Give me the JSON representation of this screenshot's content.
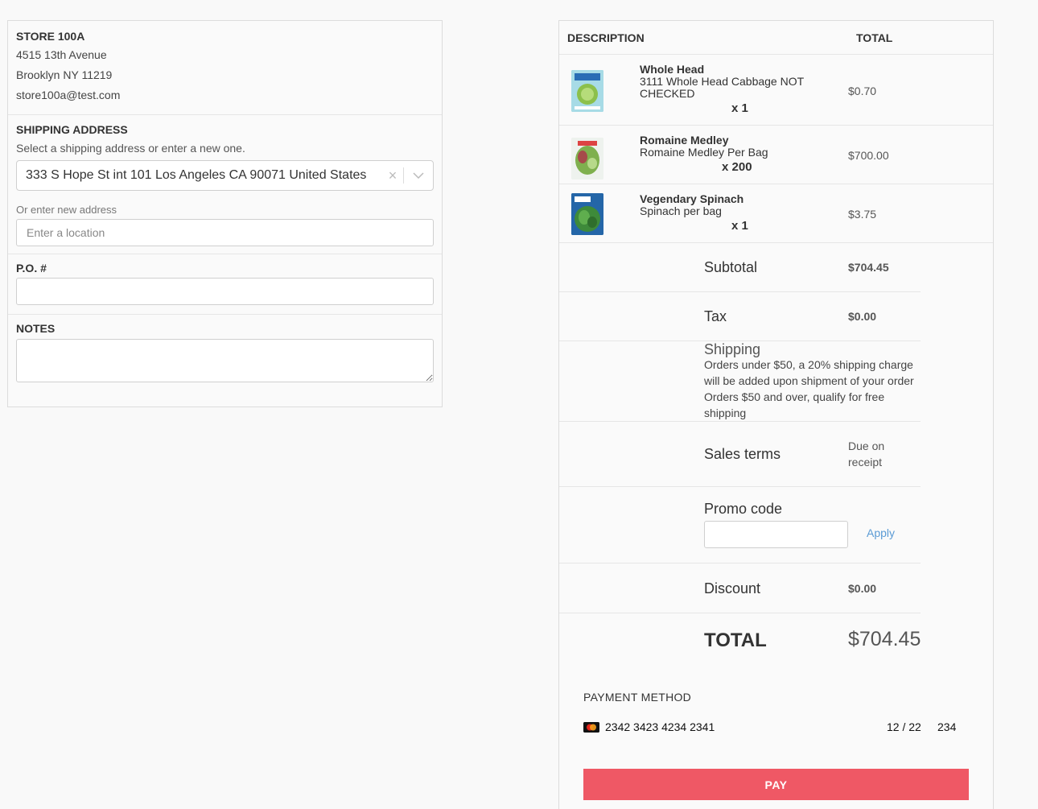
{
  "store": {
    "name": "STORE 100A",
    "street": "4515 13th Avenue",
    "city": "Brooklyn NY 11219",
    "email": "store100a@test.com"
  },
  "shipping": {
    "title": "SHIPPING ADDRESS",
    "helper": "Select a shipping address or enter a new one.",
    "selected_address": "333 S Hope St int 101 Los Angeles CA 90071 United States",
    "clear_glyph": "×",
    "new_address_label": "Or enter new address",
    "new_address_placeholder": "Enter a location"
  },
  "po": {
    "title": "P.O. #",
    "value": ""
  },
  "notes": {
    "title": "NOTES",
    "value": ""
  },
  "order": {
    "header_description": "DESCRIPTION",
    "header_total": "TOTAL",
    "items": [
      {
        "title": "Whole Head",
        "description": "3111 Whole Head Cabbage NOT CHECKED",
        "quantity": "x 1",
        "price": "$0.70",
        "thumb_icon": "cabbage-product-image"
      },
      {
        "title": "Romaine Medley",
        "description": "Romaine Medley Per Bag",
        "quantity": "x 200",
        "price": "$700.00",
        "thumb_icon": "romaine-product-image"
      },
      {
        "title": "Vegendary Spinach",
        "description": "Spinach per bag",
        "quantity": "x 1",
        "price": "$3.75",
        "thumb_icon": "spinach-product-image"
      }
    ]
  },
  "summary": {
    "subtotal_label": "Subtotal",
    "subtotal_value": "$704.45",
    "tax_label": "Tax",
    "tax_value": "$0.00",
    "shipping_label": "Shipping",
    "shipping_note": "Orders under $50, a 20% shipping charge will be added upon shipment of your order Orders $50 and over, qualify for free shipping",
    "sales_terms_label": "Sales terms",
    "sales_terms_value": "Due on receipt",
    "promo_label": "Promo code",
    "promo_value": "",
    "apply_label": "Apply",
    "discount_label": "Discount",
    "discount_value": "$0.00",
    "total_label": "TOTAL",
    "total_value": "$704.45"
  },
  "payment": {
    "title": "PAYMENT METHOD",
    "card_number": "2342 3423 4234 2341",
    "expiry": "12 / 22",
    "cvc": "234",
    "card_brand_icon": "mastercard-icon",
    "pay_label": "PAY",
    "pay_color": "#ef5865"
  },
  "colors": {
    "link": "#5b9bd5",
    "border": "#dcdcdc"
  }
}
